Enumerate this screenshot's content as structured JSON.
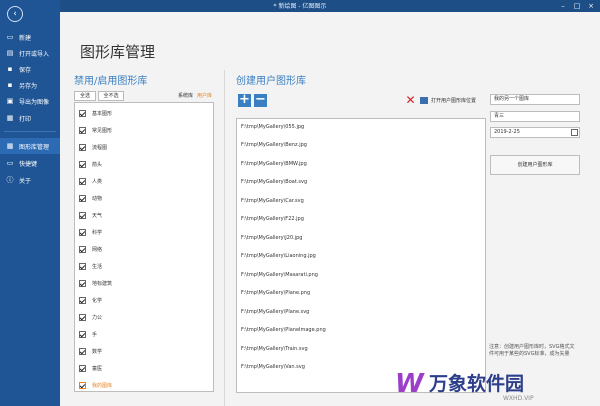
{
  "window": {
    "title": "* 新绘图 - 亿图图示"
  },
  "sidebar": {
    "items": [
      {
        "label": "新建",
        "icon": "new-file-icon"
      },
      {
        "label": "打开或导入",
        "icon": "open-folder-icon"
      },
      {
        "label": "保存",
        "icon": "save-icon"
      },
      {
        "label": "另存为",
        "icon": "save-as-icon"
      },
      {
        "label": "导出为图像",
        "icon": "export-image-icon"
      },
      {
        "label": "打印",
        "icon": "print-icon"
      },
      {
        "label": "图形库管理",
        "icon": "library-icon"
      },
      {
        "label": "快捷键",
        "icon": "keyboard-icon"
      },
      {
        "label": "关于",
        "icon": "info-icon"
      }
    ]
  },
  "main": {
    "title": "图形库管理",
    "left": {
      "title": "禁用/启用图形库",
      "select_all": "全选",
      "select_none": "全不选",
      "tab_system": "系统库",
      "tab_user": "用户库",
      "libraries": [
        "基本图形",
        "常见图形",
        "流程图",
        "箭头",
        "人类",
        "动物",
        "天气",
        "科学",
        "网络",
        "生活",
        "地标建筑",
        "化学",
        "力公",
        "手",
        "数学",
        "童医",
        "我的图库"
      ]
    },
    "right": {
      "title": "创建用户图形库",
      "open_location": "打开用户图形库位置",
      "files": [
        "F:\\tmp\\MyGallery\\055.jpg",
        "F:\\tmp\\MyGallery\\Benz.jpg",
        "F:\\tmp\\MyGallery\\BMW.jpg",
        "F:\\tmp\\MyGallery\\Boat.svg",
        "F:\\tmp\\MyGallery\\Car.svg",
        "F:\\tmp\\MyGallery\\F22.jpg",
        "F:\\tmp\\MyGallery\\J20.jpg",
        "F:\\tmp\\MyGallery\\Liaoning.jpg",
        "F:\\tmp\\MyGallery\\Masarati.png",
        "F:\\tmp\\MyGallery\\Plane.png",
        "F:\\tmp\\MyGallery\\Plane.svg",
        "F:\\tmp\\MyGallery\\PlaneImage.png",
        "F:\\tmp\\MyGallery\\Train.svg",
        "F:\\tmp\\MyGallery\\Van.svg"
      ],
      "name_value": "我的另一个图库",
      "author_value": "青三",
      "date_value": "2019-2-25",
      "create_label": "创建用户图形库",
      "note": "注意：创建用户图形库时，SVG格式文件可用于某些的SVG标准，成为矢量"
    }
  },
  "watermark": {
    "brand": "万象软件园",
    "sub": "WXHD.VIP"
  },
  "colors": {
    "sidebar": "#1f5595",
    "accent": "#3a7fc2",
    "orange": "#e8821e",
    "delete": "#d42020"
  }
}
